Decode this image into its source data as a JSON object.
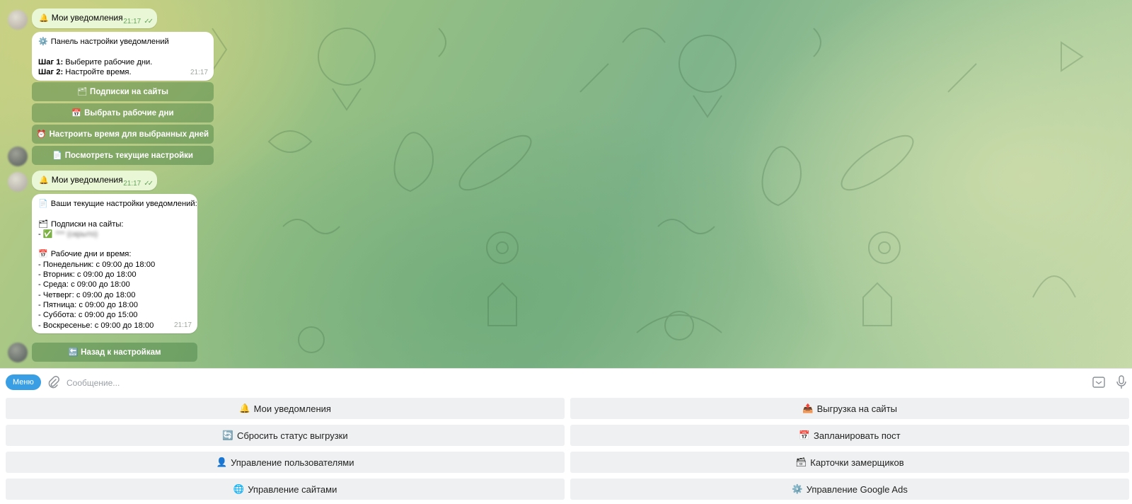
{
  "chat": {
    "messages": [
      {
        "text": "Мои уведомления",
        "time": "21:17",
        "status": "read",
        "emoji": "🔔"
      },
      {
        "emoji": "⚙️",
        "title": "Панель настройки уведомлений",
        "step1_label": "Шаг 1:",
        "step1_text": " Выберите рабочие дни.",
        "step2_label": "Шаг 2:",
        "step2_text": " Настройте время.",
        "time": "21:17",
        "buttons": [
          {
            "emoji": "🗂",
            "label": "Подписки на сайты"
          },
          {
            "emoji": "📅",
            "label": "Выбрать рабочие дни"
          },
          {
            "emoji": "⏰",
            "label": "Настроить время для выбранных дней"
          },
          {
            "emoji": "📄",
            "label": "Посмотреть текущие настройки"
          }
        ]
      },
      {
        "text": "Мои уведомления",
        "time": "21:17",
        "status": "read",
        "emoji": "🔔"
      },
      {
        "emoji": "📄",
        "title": "Ваши текущие настройки уведомлений:",
        "subs_emoji": "🗂",
        "subs_title": "Подписки на сайты:",
        "subs_item_prefix": "- ",
        "subs_item_emoji": "✅",
        "subs_item_blurred": "*** (скрыто)",
        "days_emoji": "📅",
        "days_title": "Рабочие дни и время:",
        "days": [
          "- Понедельник: с 09:00 до 18:00",
          "- Вторник: с 09:00 до 18:00",
          "- Среда: с 09:00 до 18:00",
          "- Четверг: с 09:00 до 18:00",
          "- Пятница: с 09:00 до 18:00",
          "- Суббота: с 09:00 до 15:00",
          "- Воскресенье: с 09:00 до 18:00"
        ],
        "time": "21:17",
        "buttons": [
          {
            "emoji": "🔙",
            "label": "Назад к настройкам"
          }
        ]
      }
    ]
  },
  "input": {
    "menu_label": "Меню",
    "placeholder": "Сообщение..."
  },
  "reply_keyboard": [
    {
      "emoji": "🔔",
      "label": "Мои уведомления"
    },
    {
      "emoji": "📤",
      "label": "Выгрузка на сайты"
    },
    {
      "emoji": "🔄",
      "label": "Сбросить статус выгрузки"
    },
    {
      "emoji": "📅",
      "label": "Запланировать пост"
    },
    {
      "emoji": "👤",
      "label": "Управление пользователями"
    },
    {
      "emoji": "🗃",
      "label": "Карточки замерщиков"
    },
    {
      "emoji": "🌐",
      "label": "Управление сайтами"
    },
    {
      "emoji": "⚙️",
      "label": "Управление Google Ads"
    }
  ],
  "colors": {
    "menu_button": "#3a9ee4",
    "outgoing_bubble": "#eaf7d6",
    "read_ticks": "#64a65c",
    "inline_button": "rgba(60,120,60,0.42)",
    "reply_button": "#eff0f1"
  },
  "icons": [
    "bell-icon",
    "gear-icon",
    "card-index-icon",
    "calendar-icon",
    "alarm-clock-icon",
    "page-icon",
    "back-arrow-icon",
    "check-mark-icon",
    "paperclip-icon",
    "keyboard-toggle-icon",
    "microphone-icon",
    "outbox-icon",
    "refresh-icon",
    "bust-icon",
    "card-file-box-icon",
    "globe-icon"
  ]
}
